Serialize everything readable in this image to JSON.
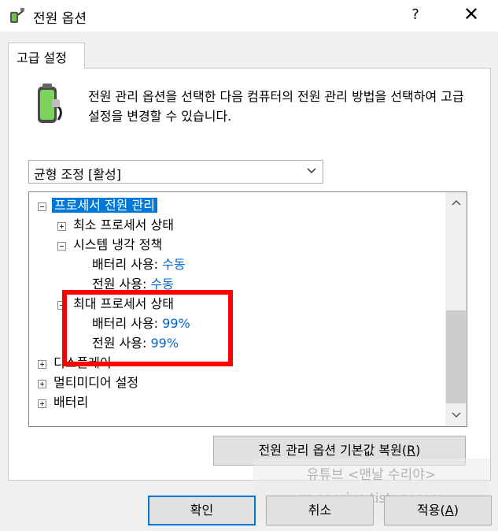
{
  "window": {
    "title": "전원 옵션",
    "help_label": "?",
    "close_label": "✕"
  },
  "tab": {
    "label": "고급 설정"
  },
  "description": "전원 관리 옵션을 선택한 다음 컴퓨터의 전원 관리 방법을 선택하여 고급 설정을 변경할 수 있습니다.",
  "scheme_select": {
    "value": "균형 조정 [활성]"
  },
  "tree": {
    "root": "프로세서 전원 관리",
    "min_state": "최소 프로세서 상태",
    "cooling": "시스템 냉각 정책",
    "cooling_battery_label": "배터리 사용:",
    "cooling_battery_value": "수동",
    "cooling_ac_label": "전원 사용:",
    "cooling_ac_value": "수동",
    "max_state": "최대 프로세서 상태",
    "max_battery_label": "배터리 사용:",
    "max_battery_value": "99%",
    "max_ac_label": "전원 사용:",
    "max_ac_value": "99%",
    "display": "디스플레이",
    "multimedia": "멀티미디어 설정",
    "battery": "배터리"
  },
  "buttons": {
    "restore_text": "전원 관리 옵션 기본값 복원",
    "restore_key": "R",
    "ok": "확인",
    "cancel": "취소",
    "apply_text": "적용",
    "apply_key": "A"
  },
  "watermark": {
    "line1": "유튜브 <맨날 수리야>",
    "line2": "m-sooriya.tistory.com"
  }
}
